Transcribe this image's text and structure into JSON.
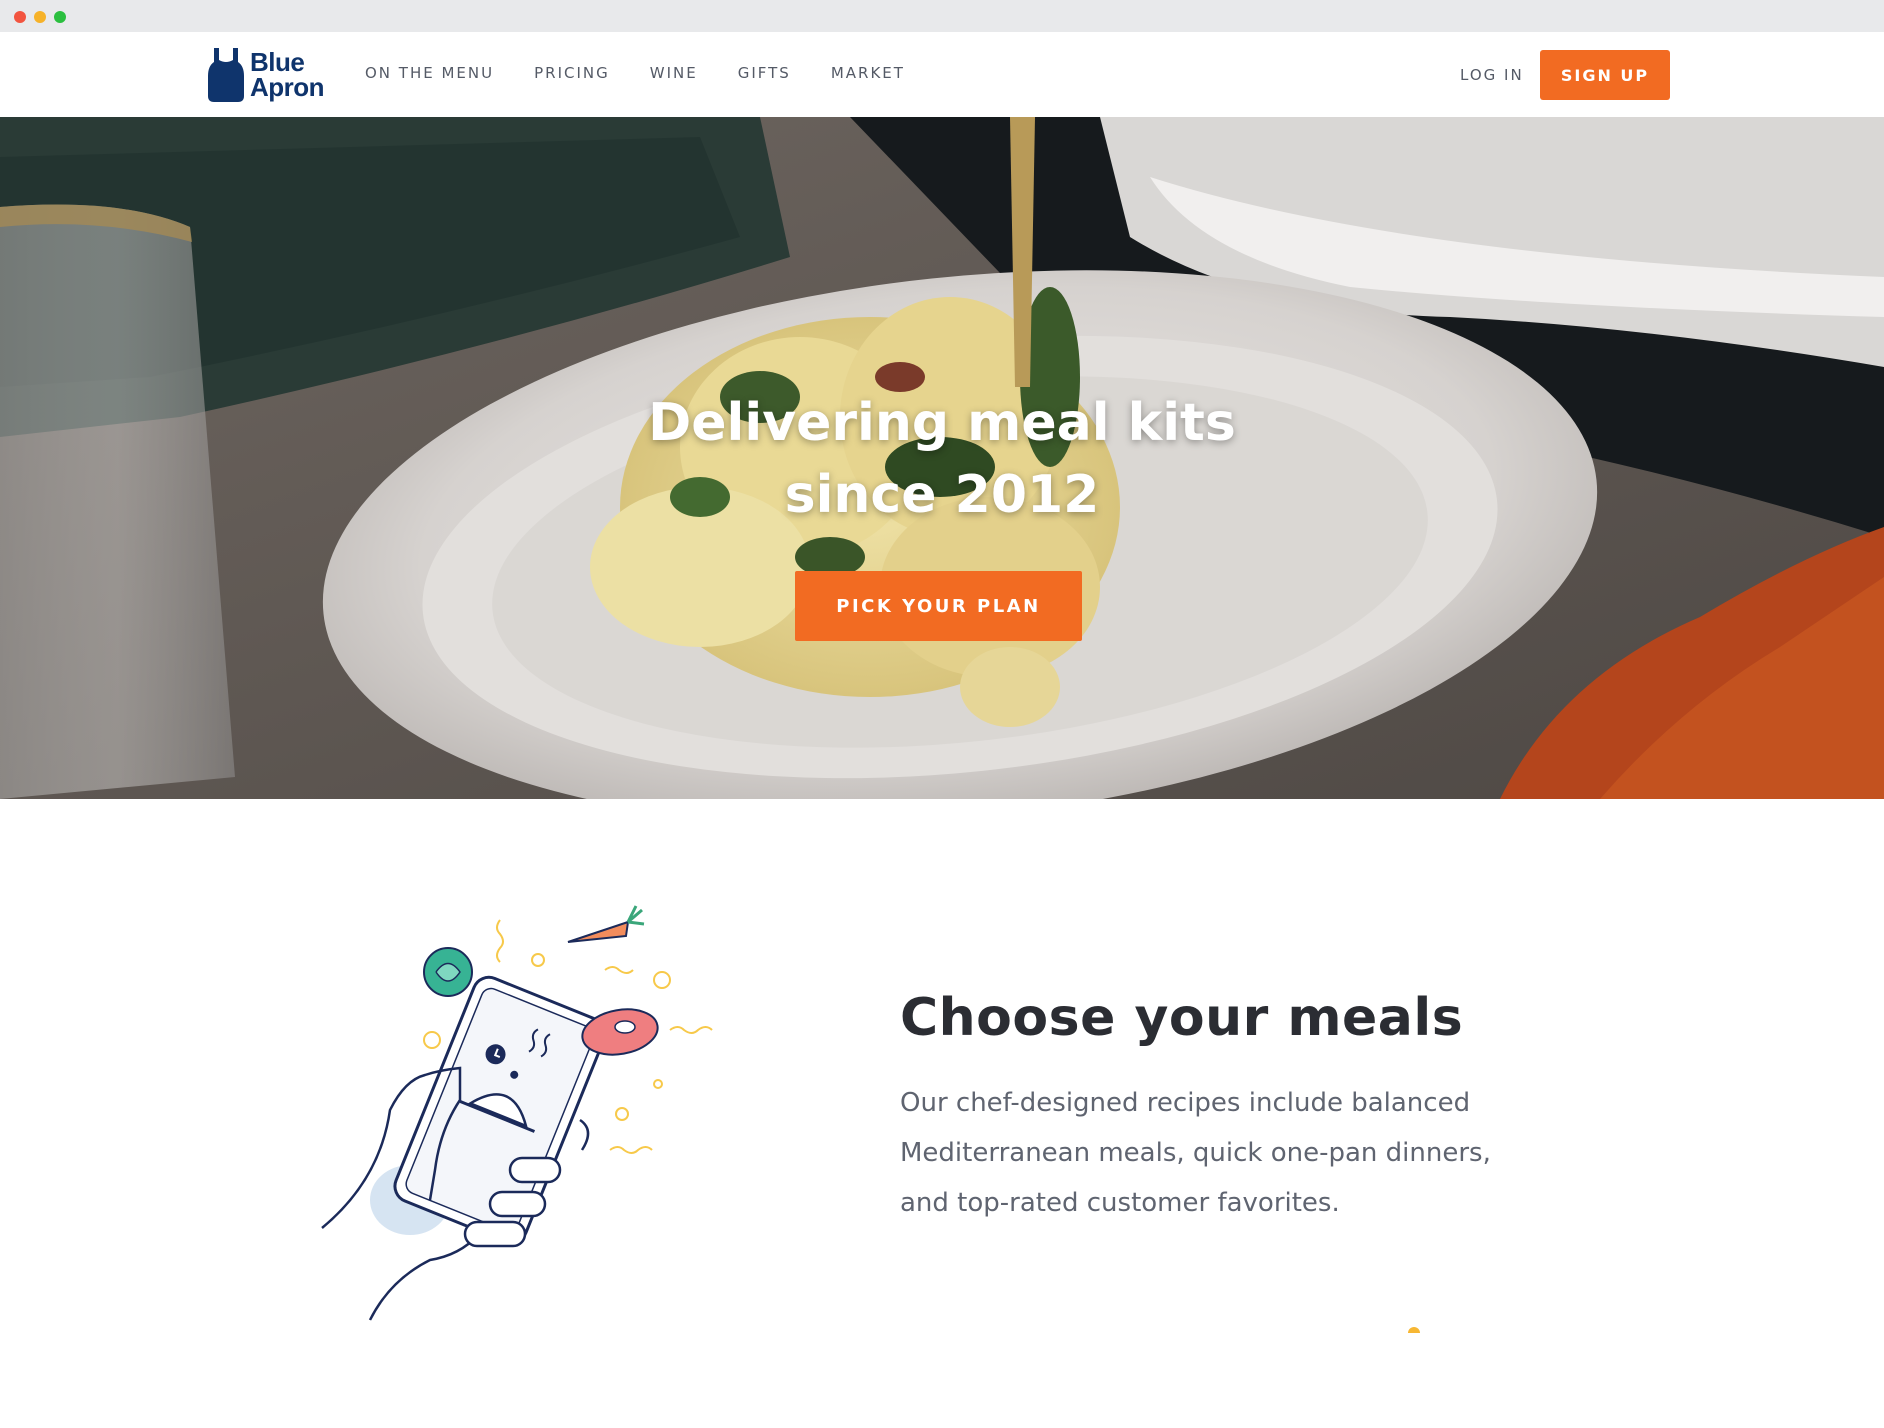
{
  "colors": {
    "brand_navy": "#0f346c",
    "accent_orange": "#f26b22",
    "nav_text": "#545a66",
    "heading": "#2b2d33",
    "body_text": "#5f6470"
  },
  "brand": {
    "logo_line1": "Blue",
    "logo_line2": "Apron",
    "logo_icon": "apron-icon"
  },
  "nav": {
    "items": [
      {
        "label": "ON THE MENU"
      },
      {
        "label": "PRICING"
      },
      {
        "label": "WINE"
      },
      {
        "label": "GIFTS"
      },
      {
        "label": "MARKET"
      }
    ],
    "login_label": "LOG IN",
    "signup_label": "SIGN UP"
  },
  "hero": {
    "title_line1": "Delivering meal kits",
    "title_line2": "since 2012",
    "cta_label": "PICK YOUR PLAN"
  },
  "feature": {
    "title": "Choose your meals",
    "body": "Our chef-designed recipes include balanced Mediterranean meals, quick one-pan dinners, and top-rated customer favorites.",
    "illustration": "hand-holding-phone-with-food-icons"
  }
}
